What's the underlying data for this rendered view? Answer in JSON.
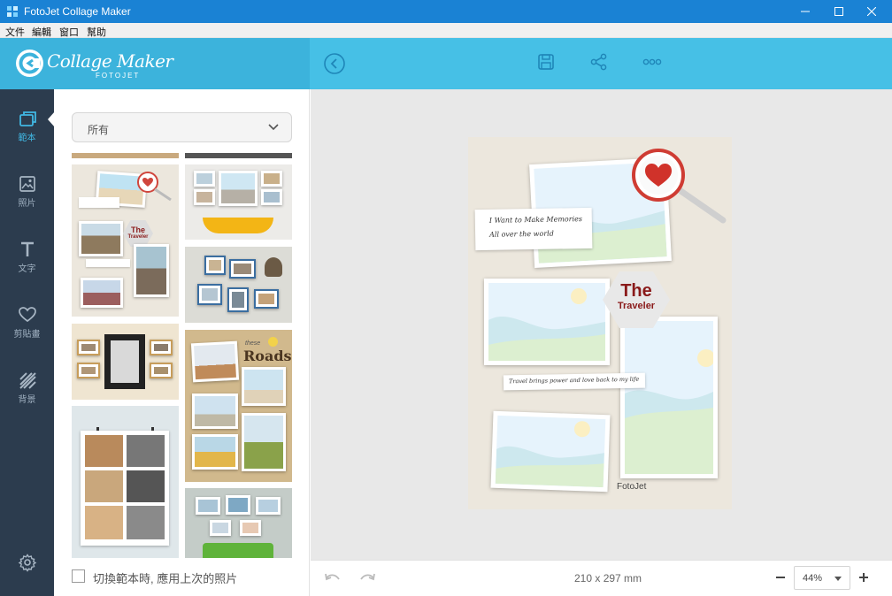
{
  "window": {
    "title": "FotoJet Collage Maker"
  },
  "menu": [
    "文件",
    "編輯",
    "窗口",
    "幫助"
  ],
  "logo": {
    "title": "Collage Maker",
    "subtitle": "FOTOJET"
  },
  "nav": [
    {
      "label": "範本",
      "icon": "template-icon",
      "active": true
    },
    {
      "label": "照片",
      "icon": "photo-icon",
      "active": false
    },
    {
      "label": "文字",
      "icon": "text-icon",
      "active": false
    },
    {
      "label": "剪貼畫",
      "icon": "heart-icon",
      "active": false
    },
    {
      "label": "背景",
      "icon": "background-icon",
      "active": false
    }
  ],
  "panel": {
    "category": "所有",
    "reuse_photos_label": "切換範本時, 應用上次的照片"
  },
  "thumbnails": {
    "traveler_title": "The",
    "traveler_sub": "Traveler",
    "roads_small": "these",
    "roads_title": "Roads"
  },
  "canvas": {
    "note_line1": "I Want to Make Memories",
    "note_line2": "All over the world",
    "title": "The",
    "subtitle": "Traveler",
    "caption": "Travel brings power and love back to my life",
    "brand": "FotoJet",
    "dimensions": "210 x 297 mm",
    "zoom": "44%"
  },
  "colors": {
    "titlebar": "#1a82d4",
    "header_left": "#3cb3dc",
    "header_right": "#46c0e6",
    "nav_bg": "#2c3c4e",
    "accent": "#40b8e4",
    "title_red": "#8a1a1a"
  }
}
